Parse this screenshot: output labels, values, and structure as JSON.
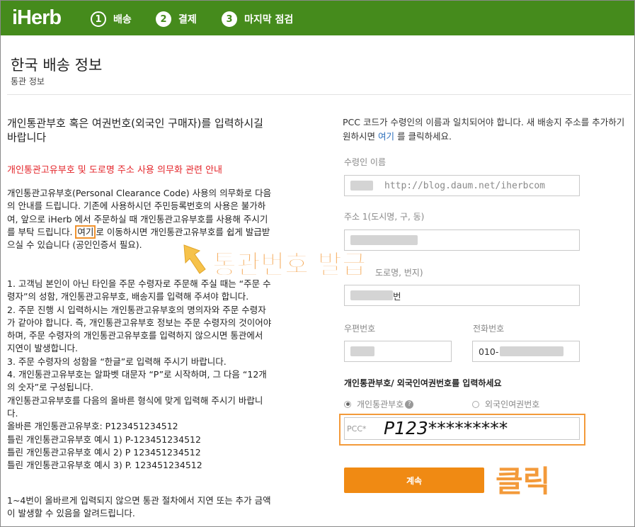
{
  "header": {
    "logo": "iHerb",
    "steps": [
      {
        "num": "1",
        "label": "배송"
      },
      {
        "num": "2",
        "label": "결제"
      },
      {
        "num": "3",
        "label": "마지막 점검"
      }
    ]
  },
  "page": {
    "title": "한국 배송 정보",
    "subtitle": "통관 정보"
  },
  "left": {
    "title": "개인통관부호 혹은 여권번호(외국인 구매자)를 입력하시길 바랍니다",
    "notice_link": "개인통관고유부호 및 도로명 주소 사용 의무화 관련 안내",
    "para1_before": "개인통관고유부호(Personal Clearance Code) 사용의 의무화로 다음의 안내를 드립니다. 기존에 사용하시던 주민등록번호의 사용은 불가하여, 앞으로 iHerb 에서 주문하실 때 개인통관고유부호를 사용해 주시기를 부탁 드립니다. ",
    "para1_link": "여기",
    "para1_after": "로 이동하시면 개인통관고유부호를 쉽게 발급받으실 수 있습니다 (공인인증서 필요).",
    "list": [
      "1. 고객님 본인이 아닌 타인을 주문 수령자로 주문해 주실 때는 “주문 수령자”의 성함, 개인통관고유부호, 배송지를 입력해 주셔야 합니다.",
      "2. 주문 진행 시 입력하시는 개인통관고유부호의 명의자와 주문 수령자가 같아야 합니다. 즉, 개인통관고유부호 정보는 주문 수령자의 것이어야 하며, 주문 수령자의 개인통관고유부호를 입력하지 않으시면 통관에서 지연이 발생합니다.",
      "3. 주문 수령자의 성함을 “한글”로 입력해 주시기 바랍니다.",
      "4. 개인통관고유부호는 알파벳 대문자 “P”로 시작하며, 그 다음 “12개의 숫자”로 구성됩니다.",
      "개인통관고유부호를 다음의 올바른 형식에 맞게 입력해 주시기 바랍니다.",
      "올바른 개인통관고유부호: P123451234512",
      "틀린 개인통관고유부호 예시 1) P-123451234512",
      "틀린 개인통관고유부호 예시 2) P 123451234512",
      "틀린 개인통관고유부호 예시 3) P. 123451234512"
    ],
    "footer": "1~4번이 올바르게 입력되지 않으면 통관 절차에서 지연 또는 추가 금액이 발생할 수 있음을 알려드립니다."
  },
  "right": {
    "info_before": "PCC 코드가 수령인의 이름과 일치되어야 합니다. 새 배송지 주소를 추가하기 원하시면 ",
    "info_link": "여기",
    "info_after": " 를 클릭하세요.",
    "recipient_label": "수령인 이름",
    "recipient_watermark": "http://blog.daum.net/iherbcom",
    "address1_label": "주소 1(도시명, 구, 동)",
    "address2_label": "도로명, 번지)",
    "address2_value": "번",
    "zip_label": "우편번호",
    "phone_label": "전화번호",
    "phone_value": "010-",
    "pcc_section_label": "개인통관부호/ 외국인여권번호를 입력하세요",
    "radio_pcc": "개인통관부호",
    "radio_passport": "외국인여권번호",
    "help_icon_glyph": "?",
    "pcc_placeholder": "PCC*",
    "pcc_value": "P123*********",
    "continue_label": "계속"
  },
  "overlays": {
    "issue_text": "통관번호 발급",
    "click_text": "클릭"
  },
  "colors": {
    "header_green": "#458b1c",
    "accent_orange": "#f08a13",
    "annotation_orange": "#f39a3a",
    "link_blue": "#2a6ebb",
    "notice_red": "#e4262b",
    "arrow_yellow": "#f6c24a"
  },
  "icons": [
    "radio-selected-icon",
    "radio-unselected-icon",
    "help-icon",
    "arrow-up-left-icon"
  ]
}
